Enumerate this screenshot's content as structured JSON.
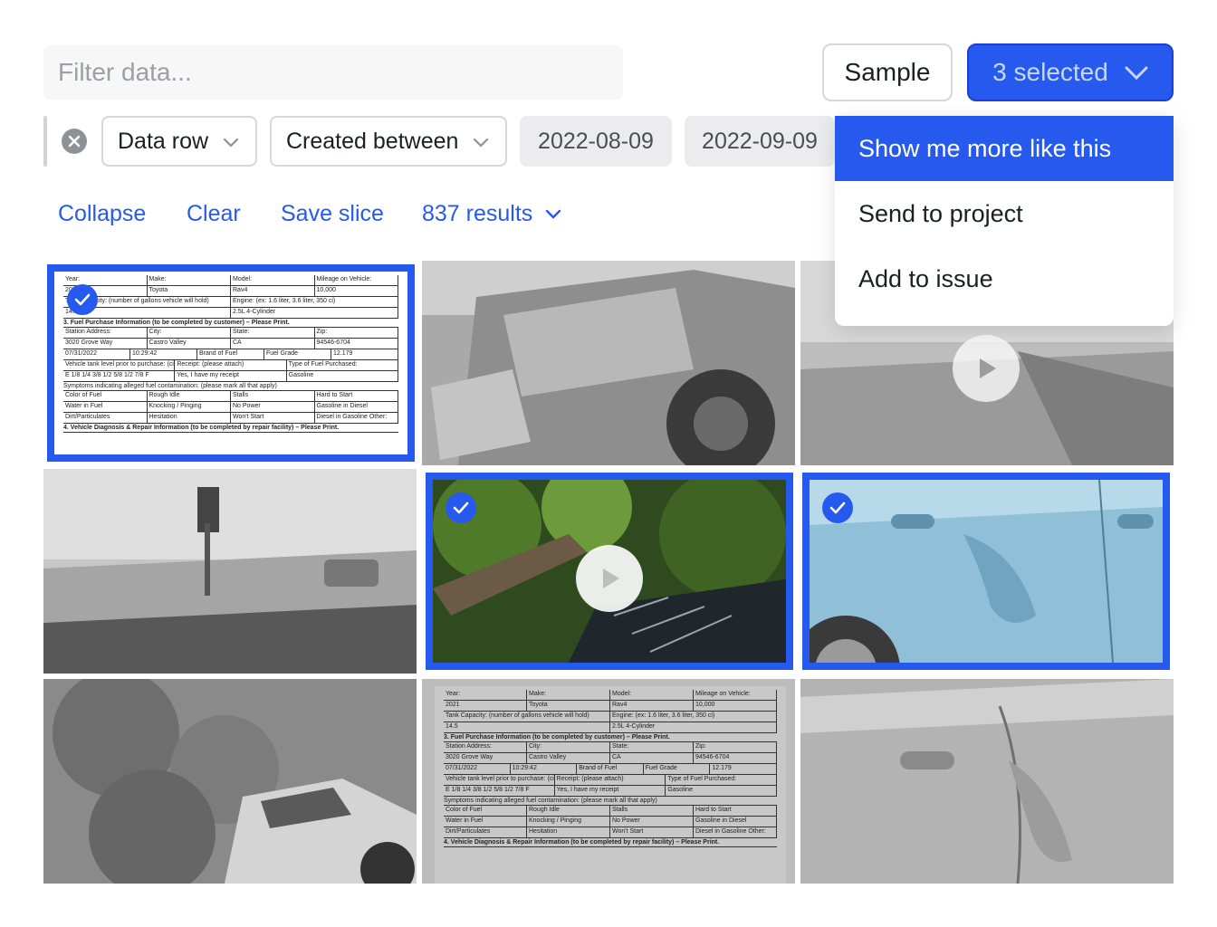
{
  "filter": {
    "placeholder": "Filter data..."
  },
  "toolbar": {
    "sample_label": "Sample",
    "selected_label": "3 selected"
  },
  "filter_row": {
    "field_label": "Data row",
    "operator_label": "Created between",
    "date_from": "2022-08-09",
    "date_to": "2022-09-09"
  },
  "actions": {
    "collapse": "Collapse",
    "clear": "Clear",
    "save_slice": "Save slice",
    "results": "837 results"
  },
  "menu": {
    "items": [
      "Show me more like this",
      "Send to project",
      "Add to issue"
    ]
  },
  "doc": {
    "row1": [
      "Year:",
      "Make:",
      "Model:",
      "Mileage on Vehicle:"
    ],
    "row2": [
      "2021",
      "Toyota",
      "Rav4",
      "10,000"
    ],
    "row3": [
      "Tank Capacity: (number of gallons vehicle will hold)",
      "Engine: (ex: 1.6 liter, 3.6 liter, 350 ci)"
    ],
    "row4": [
      "14.5",
      "2.5L 4-Cylinder"
    ],
    "section3": "3.   Fuel Purchase Information (to be completed by customer) – Please Print.",
    "row5": [
      "Station Address:",
      "City:",
      "State:",
      "Zip:"
    ],
    "row6": [
      "3020 Grove Way",
      "Castro Valley",
      "CA",
      "94546-6704"
    ],
    "row7": [
      "07/31/2022",
      "10:29:42",
      "Brand of Fuel",
      "Fuel Grade",
      "12.179"
    ],
    "row8": [
      "Vehicle tank level prior to purchase: (circle one)",
      "Receipt: (please attach)",
      "Type of Fuel Purchased:"
    ],
    "row9": [
      "E  1/8  1/4  3/8  1/2  5/8  1/2  7/8  F",
      "Yes, I have my receipt",
      "Gasoline"
    ],
    "row10": [
      "Symptoms indicating alleged fuel contamination: (please mark all that apply)"
    ],
    "row11": [
      "Color of Fuel",
      "Rough Idle",
      "Stalls",
      "Hard to Start"
    ],
    "row12": [
      "Water in Fuel",
      "Knocking / Pinging",
      "No Power",
      "Gasoline in Diesel"
    ],
    "row13": [
      "Dirt/Particulates",
      "Hesitation",
      "Won't Start",
      "Diesel in Gasoline   Other:"
    ],
    "section4": "4.   Vehicle Diagnosis & Repair Information (to be completed by repair facility) – Please Print."
  },
  "colors": {
    "accent": "#2659ee",
    "menu_active": "#2659ee"
  }
}
